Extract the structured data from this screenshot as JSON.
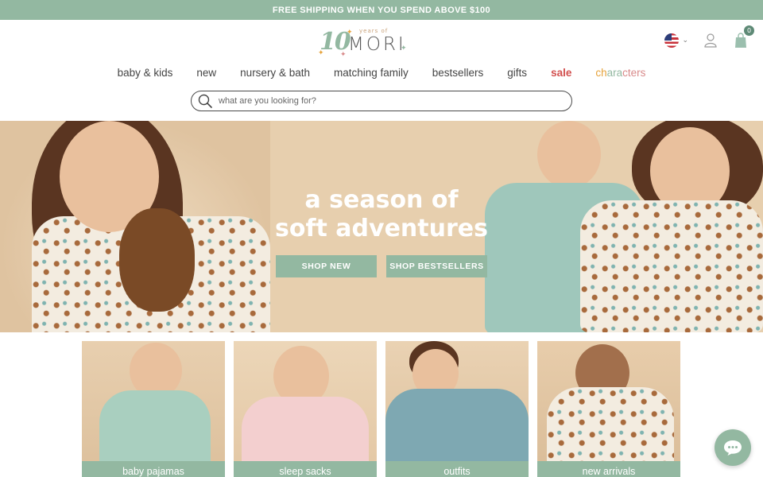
{
  "promo": {
    "text": "FREE SHIPPING WHEN YOU SPEND ABOVE $100"
  },
  "brand": {
    "logo_number": "10",
    "logo_subtitle": "years of",
    "logo_name": "MORI"
  },
  "header": {
    "locale_icon": "us-flag-icon",
    "account_icon": "user-icon",
    "cart_icon": "shopping-bag-icon",
    "cart_count": "0"
  },
  "nav": {
    "items": [
      {
        "label": "baby & kids"
      },
      {
        "label": "new"
      },
      {
        "label": "nursery & bath"
      },
      {
        "label": "matching family"
      },
      {
        "label": "bestsellers"
      },
      {
        "label": "gifts"
      },
      {
        "label": "sale"
      }
    ],
    "characters_parts": [
      "ch",
      "ara",
      "cters"
    ]
  },
  "search": {
    "placeholder": "what are you looking for?",
    "value": ""
  },
  "hero": {
    "title_line1": "a season of",
    "title_line2": "soft adventures",
    "btn_new": "SHOP NEW",
    "btn_bestsellers": "SHOP BESTSELLERS"
  },
  "categories": [
    {
      "label": "baby pajamas"
    },
    {
      "label": "sleep sacks"
    },
    {
      "label": "outfits"
    },
    {
      "label": "new arrivals"
    }
  ],
  "chat": {
    "icon": "chat-bubble-icon"
  },
  "colors": {
    "accent": "#93b8a1",
    "sale": "#d2504f",
    "hero_bg": "#e7cfae"
  }
}
